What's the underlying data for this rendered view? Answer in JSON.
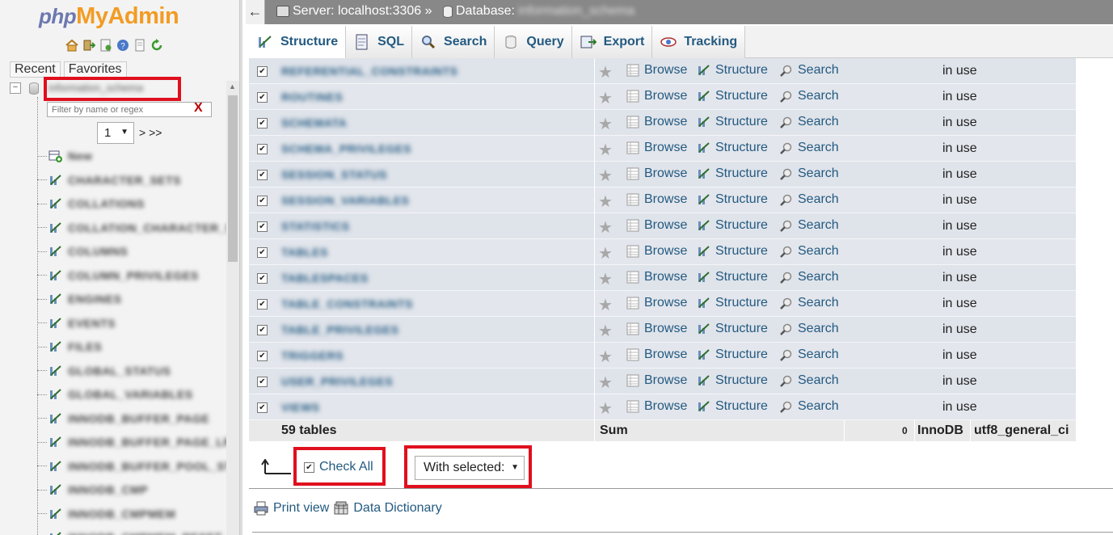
{
  "app": {
    "logo_php": "php",
    "logo_myadmin": "MyAdmin"
  },
  "nav": {
    "icons": [
      "home-icon",
      "exit-icon",
      "sql-query-icon",
      "docs-icon",
      "help-icon",
      "reload-icon"
    ],
    "tabs": {
      "recent": "Recent",
      "favorites": "Favorites"
    },
    "expander": "−",
    "db_name": "information_schema",
    "filter_placeholder": "Filter by name or regex",
    "filter_clear": "X",
    "page_value": "1",
    "page_next": "> >>",
    "tree": [
      {
        "label": "New",
        "icon": "new-table-icon"
      },
      {
        "label": "CHARACTER_SETS",
        "icon": "table-structure-icon"
      },
      {
        "label": "COLLATIONS",
        "icon": "table-structure-icon"
      },
      {
        "label": "COLLATION_CHARACTER_SET",
        "icon": "table-structure-icon"
      },
      {
        "label": "COLUMNS",
        "icon": "table-structure-icon"
      },
      {
        "label": "COLUMN_PRIVILEGES",
        "icon": "table-structure-icon"
      },
      {
        "label": "ENGINES",
        "icon": "table-structure-icon"
      },
      {
        "label": "EVENTS",
        "icon": "table-structure-icon"
      },
      {
        "label": "FILES",
        "icon": "table-structure-icon"
      },
      {
        "label": "GLOBAL_STATUS",
        "icon": "table-structure-icon"
      },
      {
        "label": "GLOBAL_VARIABLES",
        "icon": "table-structure-icon"
      },
      {
        "label": "INNODB_BUFFER_PAGE",
        "icon": "table-structure-icon"
      },
      {
        "label": "INNODB_BUFFER_PAGE_LRU",
        "icon": "table-structure-icon"
      },
      {
        "label": "INNODB_BUFFER_POOL_STATS",
        "icon": "table-structure-icon"
      },
      {
        "label": "INNODB_CMP",
        "icon": "table-structure-icon"
      },
      {
        "label": "INNODB_CMPMEM",
        "icon": "table-structure-icon"
      },
      {
        "label": "INNODB_CMPMEM_RESET",
        "icon": "table-structure-icon"
      }
    ]
  },
  "topbar": {
    "back": "←",
    "server": "Server: localhost:3306 »",
    "database_label": "Database:",
    "database_name": "information_schema"
  },
  "tabs": [
    {
      "label": "Structure",
      "icon": "structure-icon",
      "active": true
    },
    {
      "label": "SQL",
      "icon": "sql-icon",
      "active": false
    },
    {
      "label": "Search",
      "icon": "search-icon",
      "active": false
    },
    {
      "label": "Query",
      "icon": "query-icon",
      "active": false
    },
    {
      "label": "Export",
      "icon": "export-icon",
      "active": false
    },
    {
      "label": "Tracking",
      "icon": "tracking-icon",
      "active": false
    }
  ],
  "actions": {
    "browse": "Browse",
    "structure": "Structure",
    "search": "Search",
    "status": "in use"
  },
  "rows": [
    "REFERENTIAL_CONSTRAINTS",
    "ROUTINES",
    "SCHEMATA",
    "SCHEMA_PRIVILEGES",
    "SESSION_STATUS",
    "SESSION_VARIABLES",
    "STATISTICS",
    "TABLES",
    "TABLESPACES",
    "TABLE_CONSTRAINTS",
    "TABLE_PRIVILEGES",
    "TRIGGERS",
    "USER_PRIVILEGES",
    "VIEWS"
  ],
  "summary": {
    "tables": "59 tables",
    "sum": "Sum",
    "rows": "0",
    "engine": "InnoDB",
    "collation": "utf8_general_ci"
  },
  "bulk": {
    "check_all": "Check All",
    "with_selected": "With selected:"
  },
  "footer": {
    "print_view": "Print view",
    "data_dictionary": "Data Dictionary"
  },
  "colors": {
    "link": "#235a81",
    "highlight_box": "#e00f1e",
    "row_bg": "#dfe3ea",
    "logo_orange": "#f29c24",
    "logo_blue": "#6c78af"
  }
}
